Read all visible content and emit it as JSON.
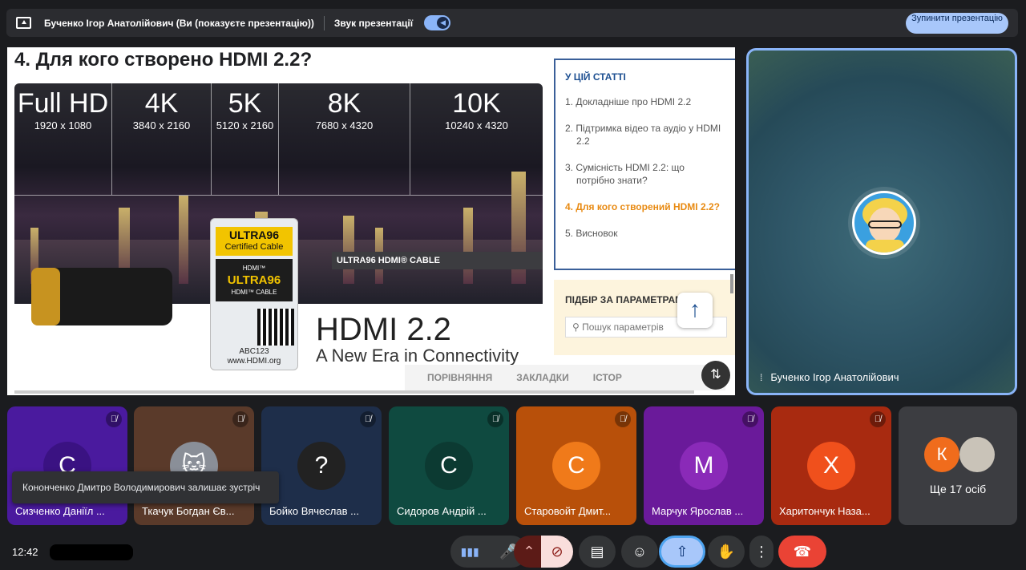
{
  "topbar": {
    "presenter": "Бученко Ігор Анатолійович (Ви (показуєте презентацію))",
    "sound_label": "Звук презентації",
    "stop_button": "Зупинити презентацію"
  },
  "slide": {
    "title": "4. Для кого створено HDMI 2.2?",
    "resolutions": [
      {
        "big": "Full HD",
        "small": "1920 x 1080"
      },
      {
        "big": "4K",
        "small": "3840 x 2160"
      },
      {
        "big": "5K",
        "small": "5120 x 2160"
      },
      {
        "big": "8K",
        "small": "7680 x 4320"
      },
      {
        "big": "10K",
        "small": "10240 x 4320"
      }
    ],
    "cable_band": "ULTRA96 HDMI® CABLE",
    "label_gold": "ULTRA96",
    "label_gold_sub": "Certified Cable",
    "label_dark_top": "HDMI™",
    "label_dark": "ULTRA96",
    "label_dark_sub": "HDMI™ CABLE",
    "label_code": "ABC123",
    "label_site": "www.HDMI.org",
    "heading": "HDMI 2.2",
    "tagline": "A New Era in Connectivity",
    "toc_title": "У ЦІЙ СТАТТІ",
    "toc": [
      "1. Докладніше про HDMI 2.2",
      "2. Підтримка відео та аудіо у HDMI 2.2",
      "3. Сумісність HDMI 2.2: що потрібно знати?",
      "4. Для кого створений HDMI 2.2?",
      "5. Висновок"
    ],
    "filter_title": "ПІДБІР ЗА ПАРАМЕТРАМИ",
    "filter_placeholder": "Пошук параметрів",
    "tabs": [
      "ПОРІВНЯННЯ",
      "ЗАКЛАДКИ",
      "ІСТОР"
    ]
  },
  "speaker": {
    "name": "Бученко Ігор Анатолійович"
  },
  "participants": [
    {
      "initial": "С",
      "name": "Сизченко Даніїл ...",
      "bg": "#4a1a9e",
      "av": "#3a1282"
    },
    {
      "initial": "",
      "name": "Ткачук Богдан Єв...",
      "bg": "#5a3a2a",
      "av": "#8a8f98"
    },
    {
      "initial": "?",
      "name": "Бойко Вячеслав ...",
      "bg": "#1e2e4a",
      "av": "#222"
    },
    {
      "initial": "С",
      "name": "Сидоров Андрій ...",
      "bg": "#0f4a40",
      "av": "#0c3a32"
    },
    {
      "initial": "С",
      "name": "Старовойт Дмит...",
      "bg": "#b8500a",
      "av": "#f07a1a"
    },
    {
      "initial": "М",
      "name": "Марчук Ярослав ...",
      "bg": "#6a1a9a",
      "av": "#8a2ab8"
    },
    {
      "initial": "Х",
      "name": "Харитончук Наза...",
      "bg": "#a82a10",
      "av": "#f0501c"
    }
  ],
  "toast": "Кононченко Дмитро Володимирович залишає зустріч",
  "more": {
    "initial": "К",
    "label": "Ще 17 осіб"
  },
  "clock": "12:42"
}
